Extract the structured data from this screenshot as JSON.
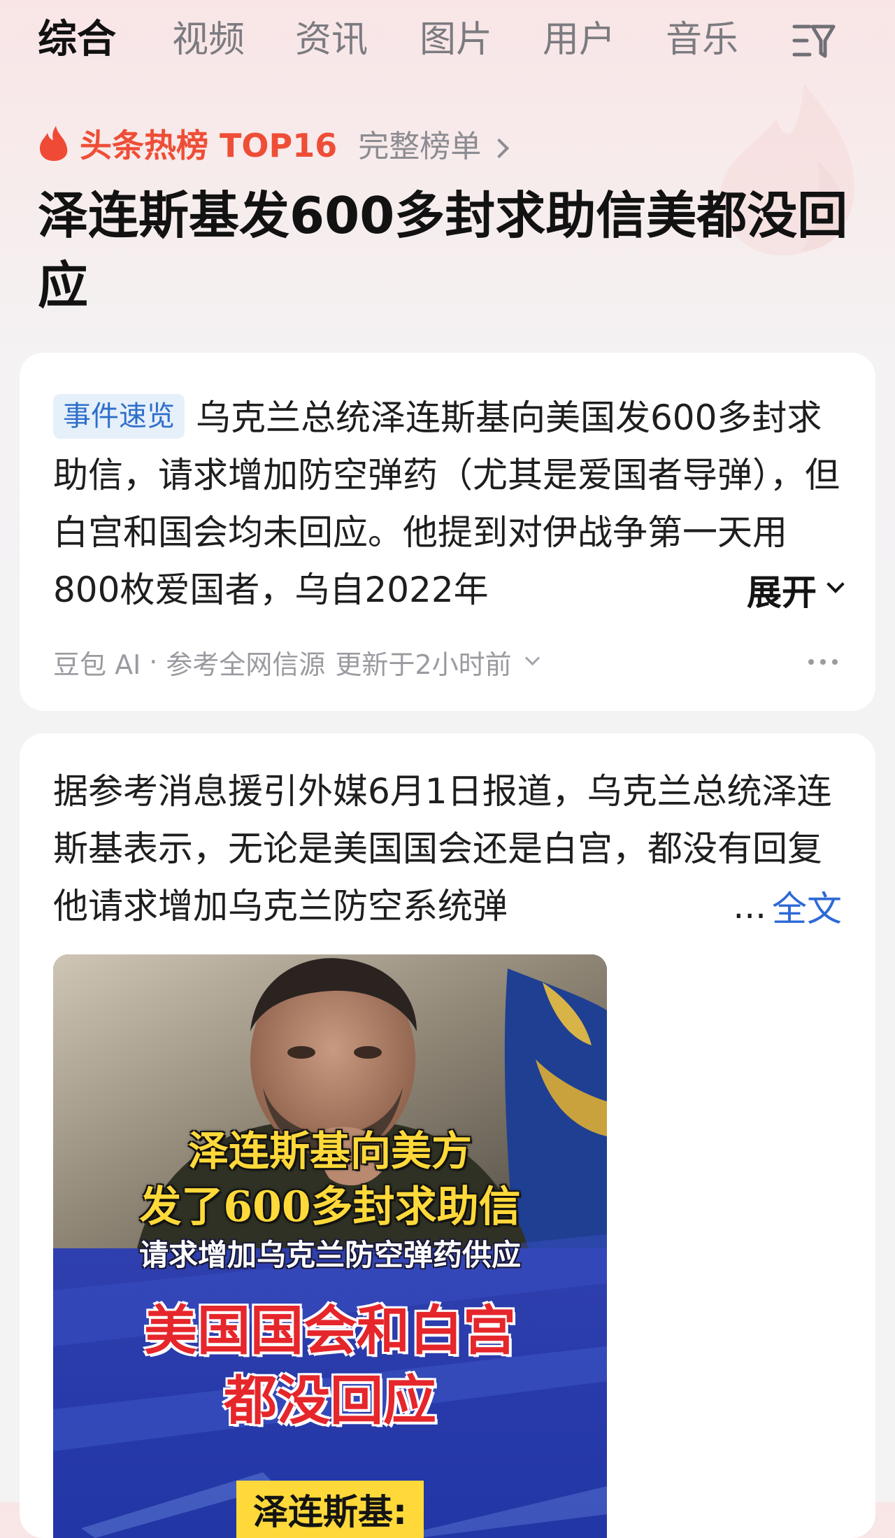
{
  "tabs": [
    {
      "label": "综合",
      "active": true
    },
    {
      "label": "视频",
      "active": false
    },
    {
      "label": "资讯",
      "active": false
    },
    {
      "label": "图片",
      "active": false
    },
    {
      "label": "用户",
      "active": false
    },
    {
      "label": "音乐",
      "active": false
    }
  ],
  "filter_icon": "filter-icon",
  "hot_list": {
    "icon": "fire-icon",
    "label": "头条热榜 TOP16",
    "full_list_link": "完整榜单",
    "headline": "泽连斯基发600多封求助信美都没回应",
    "accent_color": "#ee4e37"
  },
  "summary_card": {
    "badge": "事件速览",
    "text": "乌克兰总统泽连斯基向美国发600多封求助信，请求增加防空弹药（尤其是爱国者导弹），但白宫和国会均未回应。他提到对伊战争第一天用800枚爱国者，乌自2022年",
    "expand_label": "展开",
    "source": "豆包 AI",
    "separator": "·",
    "reference": "参考全网信源",
    "updated": "更新于2小时前",
    "more_icon": "more-dots-icon"
  },
  "article_card": {
    "text": "据参考消息援引外媒6月1日报道，乌克兰总统泽连斯基表示，无论是美国国会还是白宫，都没有回复他请求增加乌克兰防空系统弹",
    "ellipsis": "...",
    "full_text_link": "全文",
    "link_color": "#2d69d6",
    "image": {
      "line1": "泽连斯基向美方",
      "line2": "发了600多封求助信",
      "line3": "请求增加乌克兰防空弹药供应",
      "line4": "美国国会和白宫",
      "line5": "都没回应",
      "tag": "泽连斯基:"
    }
  }
}
